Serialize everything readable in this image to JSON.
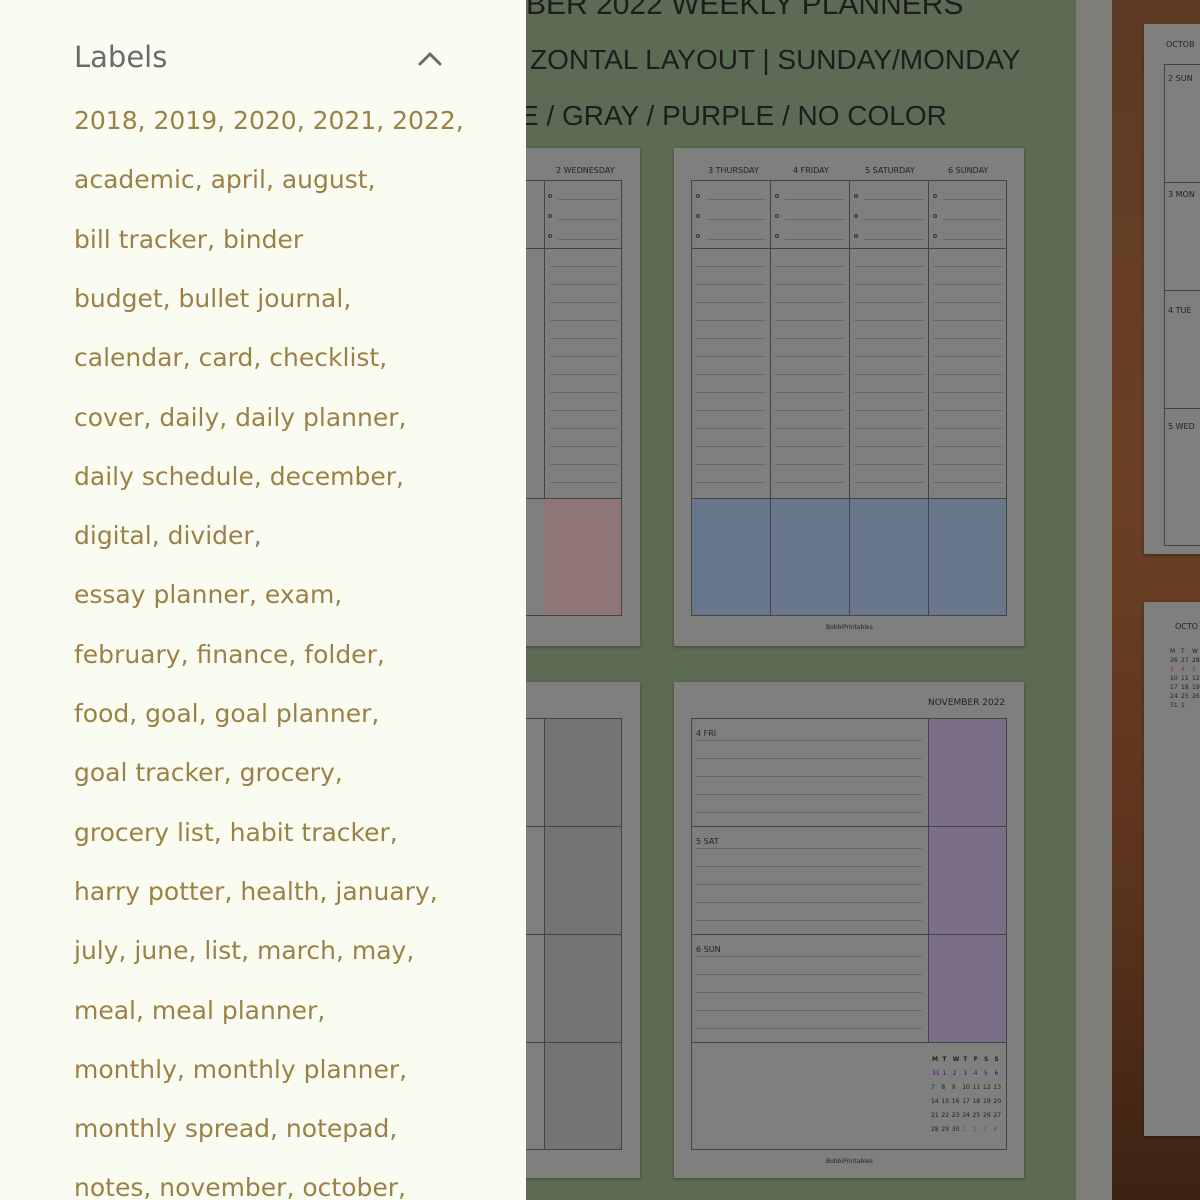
{
  "background_header": {
    "line1": "BER 2022 WEEKLY PLANNERS",
    "line2": "ZONTAL LAYOUT | SUNDAY/MONDAY",
    "line3": "E / GRAY / PURPLE / NO COLOR"
  },
  "planner_top_left": {
    "day": "2 WEDNESDAY"
  },
  "planner_top_right": {
    "days": [
      "3 THURSDAY",
      "4 FRIDAY",
      "5 SATURDAY",
      "6 SUNDAY"
    ],
    "footer": "BobbiPrintables"
  },
  "planner_bottom_right": {
    "month": "NOVEMBER 2022",
    "days": [
      "4 FRI",
      "5 SAT",
      "6 SUN"
    ],
    "footer": "BobbiPrintables",
    "mini_calendar": {
      "headers": [
        "M",
        "T",
        "W",
        "T",
        "F",
        "S",
        "S"
      ],
      "rows": [
        [
          "31",
          "1",
          "2",
          "3",
          "4",
          "5",
          "6"
        ],
        [
          "7",
          "8",
          "9",
          "10",
          "11",
          "12",
          "13"
        ],
        [
          "14",
          "15",
          "16",
          "17",
          "18",
          "19",
          "20"
        ],
        [
          "21",
          "22",
          "23",
          "24",
          "25",
          "26",
          "27"
        ],
        [
          "28",
          "29",
          "30",
          "1",
          "2",
          "3",
          "4"
        ]
      ]
    }
  },
  "planner_far_right": {
    "month": "OCTOB",
    "days": [
      "2 SUN",
      "3 MON",
      "4 TUE",
      "5 WED"
    ]
  },
  "planner_far_right_bottom": {
    "month": "OCTO",
    "headers": [
      "M",
      "T",
      "W"
    ],
    "rows": [
      [
        "26",
        "27",
        "28"
      ],
      [
        "3",
        "4",
        "5"
      ],
      [
        "10",
        "11",
        "12"
      ],
      [
        "17",
        "18",
        "19"
      ],
      [
        "24",
        "25",
        "26"
      ],
      [
        "31",
        "1",
        ""
      ]
    ]
  },
  "drawer": {
    "title": "Labels",
    "collapse_icon": "chevron-up-icon",
    "rows": [
      "2018, 2019, 2020, 2021, 2022,",
      "academic, april, august,",
      "bill tracker, binder",
      "budget, bullet journal,",
      "calendar, card, checklist,",
      "cover, daily, daily planner,",
      "daily schedule, december,",
      "digital, divider,",
      "essay planner, exam,",
      "february, finance, folder,",
      "food, goal, goal planner,",
      "goal tracker, grocery,",
      "grocery list, habit tracker,",
      "harry potter, health, january,",
      "july, june, list, march, may,",
      "meal, meal planner,",
      "monthly, monthly planner,",
      "monthly spread, notepad,",
      "notes, november, october,"
    ]
  },
  "colors": {
    "drawer_bg": "#fafcf2",
    "label_link": "#9c8147",
    "title": "#6b6b6b",
    "green_bg": "#5c6b53",
    "blue_fill": "#68788a",
    "purple_fill": "#7a6f86",
    "pink_fill": "#8e7676"
  }
}
